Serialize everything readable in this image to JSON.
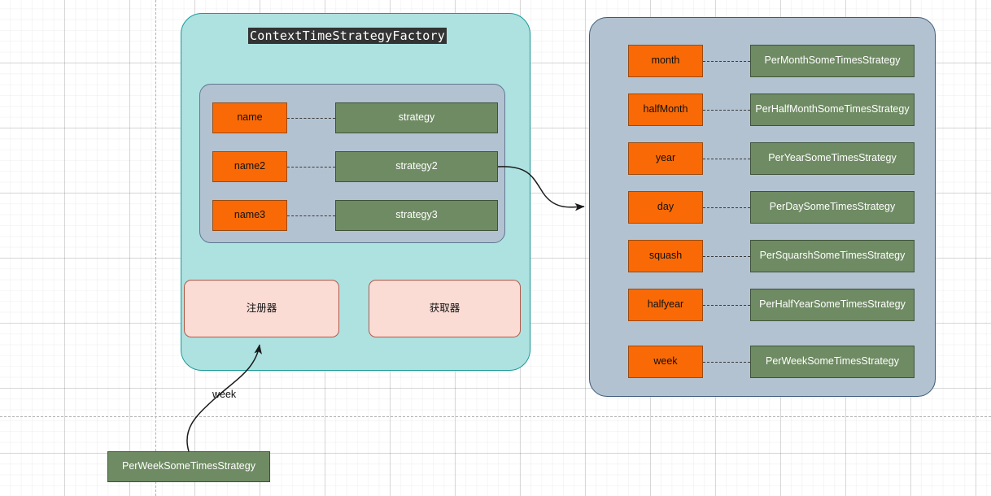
{
  "diagram": {
    "title": "ContextTimeStrategyFactory",
    "factory": {
      "title_chip": "ContextTimeStrategyFactory",
      "map_entries": [
        {
          "key": "name",
          "value": "strategy"
        },
        {
          "key": "name2",
          "value": "strategy2"
        },
        {
          "key": "name3",
          "value": "strategy3"
        }
      ],
      "operations": [
        {
          "label": "注册器"
        },
        {
          "label": "获取器"
        }
      ]
    },
    "registry": {
      "entries": [
        {
          "key": "month",
          "value": "PerMonthSomeTimesStrategy"
        },
        {
          "key": "halfMonth",
          "value": "PerHalfMonthSomeTimesStrategy"
        },
        {
          "key": "year",
          "value": "PerYearSomeTimesStrategy"
        },
        {
          "key": "day",
          "value": "PerDaySomeTimesStrategy"
        },
        {
          "key": "squash",
          "value": "PerSquarshSomeTimesStrategy"
        },
        {
          "key": "halfyear",
          "value": "PerHalfYearSomeTimesStrategy"
        },
        {
          "key": "week",
          "value": "PerWeekSomeTimesStrategy"
        }
      ]
    },
    "external_node": {
      "label": "PerWeekSomeTimesStrategy"
    },
    "edges": [
      {
        "label": "week",
        "from": "external-node",
        "to": "registrar-box"
      },
      {
        "label": "",
        "from": "strategy2-box",
        "to": "registry-panel"
      }
    ],
    "colors": {
      "panel_teal_fill": "#ade2e1",
      "panel_teal_border": "#1a9a9a",
      "panel_gray_fill": "#b3c2d1",
      "panel_gray_border": "#3d5a78",
      "node_orange_fill": "#f96a06",
      "node_orange_border": "#9a4a0d",
      "node_green_fill": "#6f8b63",
      "node_green_border": "#3f5238",
      "node_pink_fill": "#fadcd5",
      "node_pink_border": "#b05a4a",
      "title_chip_bg": "#333333",
      "title_chip_fg": "#ffffff"
    }
  }
}
